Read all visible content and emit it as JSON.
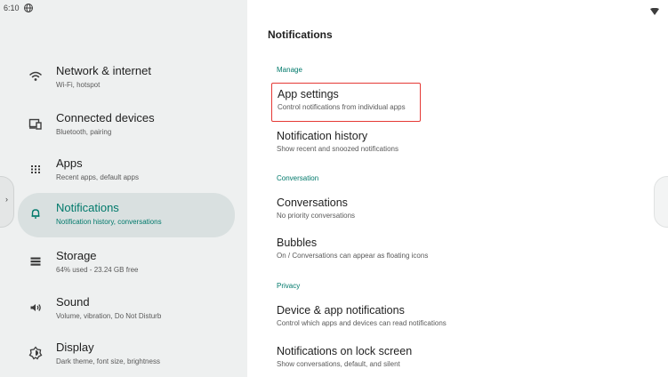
{
  "status_bar": {
    "time": "6:10"
  },
  "sidebar": {
    "items": [
      {
        "label": "Network & internet",
        "sublabel": "Wi-Fi, hotspot",
        "icon": "wifi-icon",
        "active": false
      },
      {
        "label": "Connected devices",
        "sublabel": "Bluetooth, pairing",
        "icon": "devices-icon",
        "active": false
      },
      {
        "label": "Apps",
        "sublabel": "Recent apps, default apps",
        "icon": "apps-grid-icon",
        "active": false
      },
      {
        "label": "Notifications",
        "sublabel": "Notification history, conversations",
        "icon": "bell-icon",
        "active": true
      },
      {
        "label": "Storage",
        "sublabel": "64% used - 23.24 GB free",
        "icon": "storage-icon",
        "active": false
      },
      {
        "label": "Sound",
        "sublabel": "Volume, vibration, Do Not Disturb",
        "icon": "speaker-icon",
        "active": false
      },
      {
        "label": "Display",
        "sublabel": "Dark theme, font size, brightness",
        "icon": "display-brightness-icon",
        "active": false
      }
    ]
  },
  "main": {
    "title": "Notifications",
    "sections": [
      {
        "header": "Manage"
      },
      {
        "header": "Conversation"
      },
      {
        "header": "Privacy"
      }
    ],
    "rows": [
      {
        "title": "App settings",
        "subtitle": "Control notifications from individual apps"
      },
      {
        "title": "Notification history",
        "subtitle": "Show recent and snoozed notifications"
      },
      {
        "title": "Conversations",
        "subtitle": "No priority conversations"
      },
      {
        "title": "Bubbles",
        "subtitle": "On / Conversations can appear as floating icons"
      },
      {
        "title": "Device & app notifications",
        "subtitle": "Control which apps and devices can read notifications"
      },
      {
        "title": "Notifications on lock screen",
        "subtitle": "Show conversations, default, and silent"
      }
    ]
  },
  "colors": {
    "accent": "#00796b",
    "sidebar_bg": "#eef0f0",
    "active_item_bg": "#d9e0e0",
    "highlight_border": "#e53935"
  }
}
